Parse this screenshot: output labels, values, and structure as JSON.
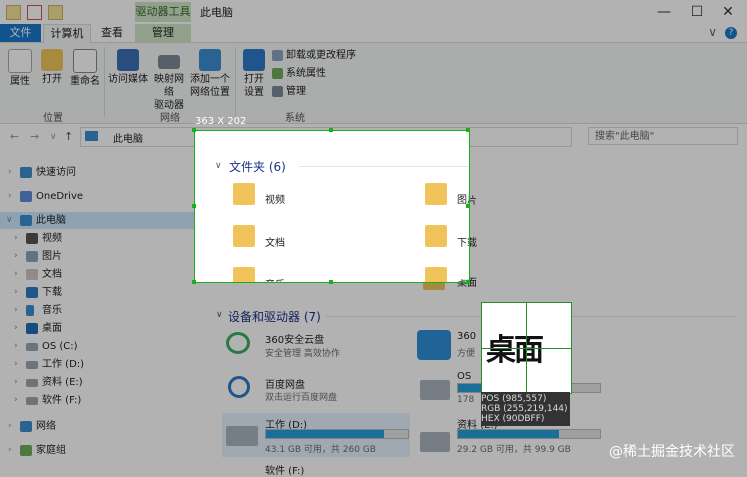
{
  "titlebar": {
    "drive_tools_label": "驱动器工具",
    "window_title": "此电脑",
    "minimize": "—",
    "maximize": "☐",
    "close": "✕"
  },
  "tabs": {
    "file": "文件",
    "computer": "计算机",
    "view": "查看",
    "manage": "管理",
    "collapse": "∨",
    "help": "?"
  },
  "ribbon": {
    "location": {
      "label": "位置",
      "properties": "属性",
      "open": "打开",
      "rename": "重命名"
    },
    "network": {
      "label": "网络",
      "access_media": "访问媒体",
      "map_drive_line1": "映射网络",
      "map_drive_line2": "驱动器",
      "add_location_line1": "添加一个",
      "add_location_line2": "网络位置"
    },
    "system": {
      "label": "系统",
      "open_settings_line1": "打开",
      "open_settings_line2": "设置",
      "uninstall": "卸载或更改程序",
      "system_properties": "系统属性",
      "manage": "管理"
    }
  },
  "address": {
    "back": "←",
    "forward": "→",
    "recent": "∨",
    "up": "↑",
    "path": "此电脑",
    "search_placeholder": "搜索\"此电脑\""
  },
  "sidebar": {
    "quick_access": "快速访问",
    "onedrive": "OneDrive",
    "this_pc": "此电脑",
    "videos": "视频",
    "pictures": "图片",
    "documents": "文档",
    "downloads": "下载",
    "music": "音乐",
    "desktop": "桌面",
    "os_c": "OS (C:)",
    "work_d": "工作 (D:)",
    "data_e": "资料 (E:)",
    "software_f": "软件 (F:)",
    "network": "网络",
    "homegroup": "家庭组"
  },
  "content": {
    "folders_header": "文件夹 (6)",
    "folders": {
      "videos": "视频",
      "pictures": "图片",
      "documents": "文档",
      "downloads": "下载",
      "music": "音乐",
      "desktop": "桌面"
    },
    "devices_header": "设备和驱动器 (7)",
    "devices": {
      "cloud360": "360安全云盘",
      "cloud360_desc": "安全管理 高效协作",
      "cloud360_b": "360",
      "cloud360_b_desc": "方便",
      "baidu": "百度网盘",
      "baidu_desc": "双击运行百度网盘",
      "os_c": "OS",
      "os_c_info": "178",
      "work_d": "工作 (D:)",
      "work_d_info": "43.1 GB 可用，共 260 GB",
      "data_e": "资料 (E:)",
      "data_e_info": "29.2 GB 可用，共 99.9 GB",
      "software_f": "软件 (F:)"
    },
    "drive_usage": {
      "os_c": 0.6,
      "work_d": 0.83,
      "data_e": 0.71
    }
  },
  "capture": {
    "size_label": "363 X 202",
    "magnifier_text": "桌面",
    "pos": "POS (985,557)",
    "rgb": "RGB (255,219,144)",
    "hex": "HEX (90DBFF)"
  },
  "watermark": "@稀土掘金技术社区",
  "colors": {
    "accent": "#1979ca",
    "selection_border": "#1ab01a",
    "folder": "#f0c45b",
    "drive_fill": "#26a0da"
  }
}
